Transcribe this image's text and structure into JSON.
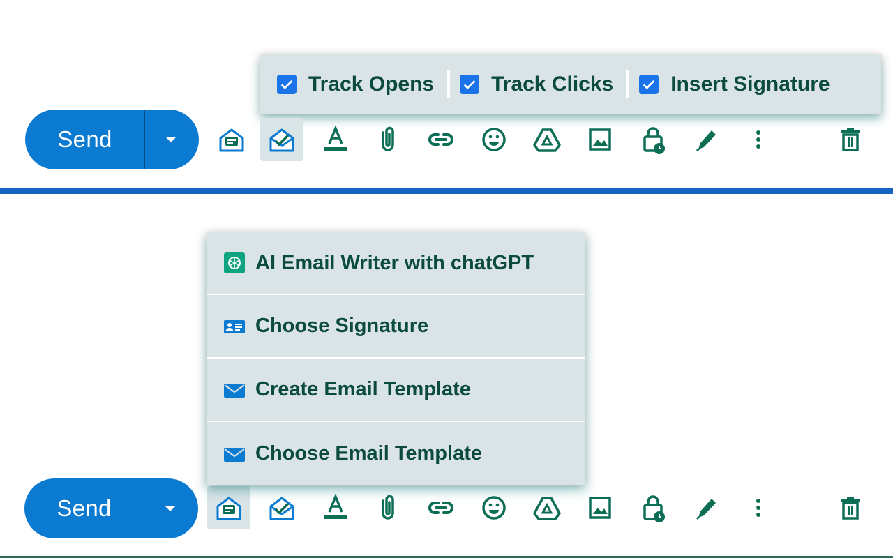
{
  "compose_top": {
    "send_label": "Send",
    "tracking_options": [
      {
        "label": "Track Opens",
        "checked": true
      },
      {
        "label": "Track Clicks",
        "checked": true
      },
      {
        "label": "Insert Signature",
        "checked": true
      }
    ],
    "active_tool": "tracking-envelope-icon"
  },
  "compose_bottom": {
    "send_label": "Send",
    "menu_items": [
      {
        "label": "AI Email Writer with chatGPT",
        "icon": "chatgpt-icon"
      },
      {
        "label": "Choose Signature",
        "icon": "id-card-icon"
      },
      {
        "label": "Create Email Template",
        "icon": "envelope-icon"
      },
      {
        "label": "Choose Email Template",
        "icon": "envelope-icon"
      }
    ],
    "active_tool": "template-envelope-icon"
  },
  "toolbar_icons": [
    "template-envelope-icon",
    "tracking-envelope-icon",
    "text-format-icon",
    "attachment-icon",
    "link-icon",
    "emoji-icon",
    "drive-icon",
    "image-icon",
    "confidential-lock-icon",
    "signature-pen-icon",
    "more-options-icon",
    "trash-icon"
  ],
  "colors": {
    "send_button": "#0b7ad1",
    "icon": "#0d6e56",
    "popup_bg": "#dae4e7",
    "checkbox": "#1a73e8",
    "divider": "#1565c0"
  }
}
